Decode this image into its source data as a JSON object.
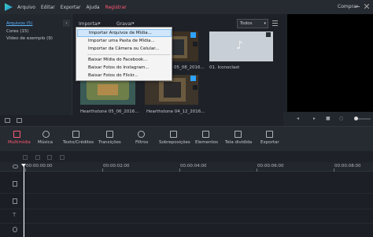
{
  "menubar": {
    "items": [
      "Arquivo",
      "Editar",
      "Exportar",
      "Ajuda"
    ],
    "register": "Registrar",
    "buy": "Comprar"
  },
  "library": {
    "items": [
      {
        "label": "Arquivos (5)",
        "active": true
      },
      {
        "label": "Cores (15)",
        "active": false
      },
      {
        "label": "Vídeo de exemplo (9)",
        "active": false
      }
    ]
  },
  "media_toolbar": {
    "import_label": "Importar",
    "record_label": "Gravar",
    "filter_value": "Todos"
  },
  "import_menu": {
    "items": [
      "Importar Arquivos de Mídia...",
      "Importar uma Pasta de Mídia...",
      "Importar da Câmera ou Celular...",
      "Baixar Mídia do Facebook...",
      "Baixar Fotos do Instagram...",
      "Baixar Fotos do Flickr..."
    ]
  },
  "media_items": [
    {
      "label": "05_08_2016..."
    },
    {
      "label": "01. Iconoclast"
    },
    {
      "label": "Hearthstone 05_06_2016..."
    },
    {
      "label": "Hearthstone 04_12_2016..."
    }
  ],
  "categories": [
    {
      "label": "Multimídia",
      "icon": "folder-icon",
      "active": true
    },
    {
      "label": "Música",
      "icon": "music-note-icon",
      "active": false
    },
    {
      "label": "Texto/Créditos",
      "icon": "text-icon",
      "active": false
    },
    {
      "label": "Transições",
      "icon": "transition-icon",
      "active": false
    },
    {
      "label": "Filtros",
      "icon": "filter-icon",
      "active": false
    },
    {
      "label": "Sobreposições",
      "icon": "overlay-icon",
      "active": false
    },
    {
      "label": "Elementos",
      "icon": "image-icon",
      "active": false
    },
    {
      "label": "Tela dividida",
      "icon": "split-screen-icon",
      "active": false
    },
    {
      "label": "Exportar",
      "icon": "export-icon",
      "active": false
    }
  ],
  "timeline": {
    "ruler": [
      "00:00:00:00",
      "00:00:02:00",
      "00:00:04:00",
      "00:00:06:00",
      "00:00:08:00"
    ]
  },
  "colors": {
    "accent": "#ff5a73",
    "selection": "#2fa3ff"
  }
}
